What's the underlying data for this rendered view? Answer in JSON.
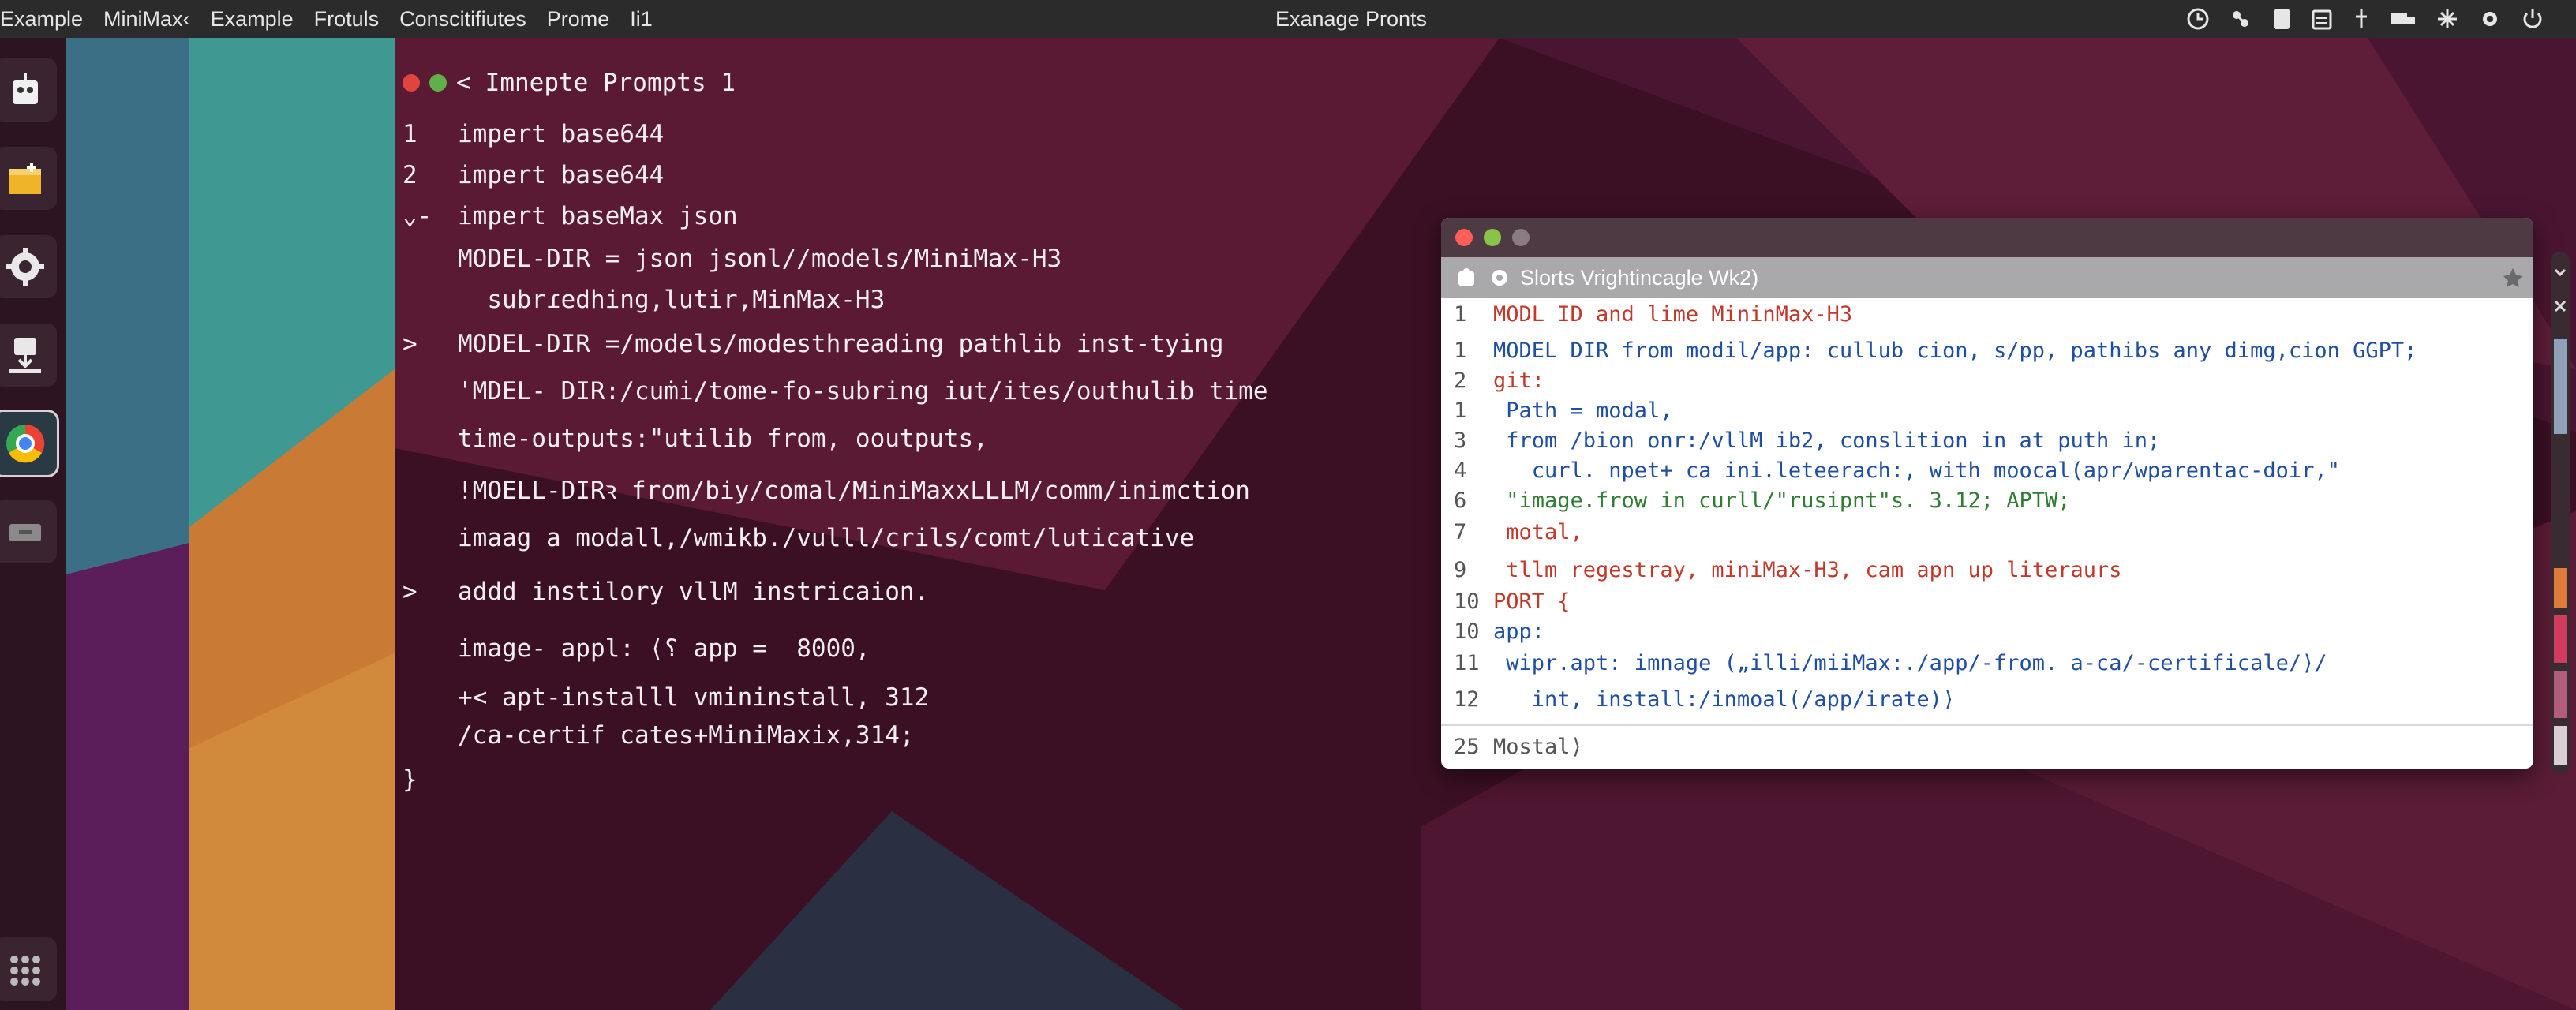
{
  "topbar": {
    "menu": [
      "Example",
      "MiniMax‹",
      "Example",
      "Frotuls",
      "Conscitifiutes",
      "Prome",
      "Ii1"
    ],
    "title": "Exanage Pronts"
  },
  "colors": {
    "topbar_bg": "#2b2b2b",
    "wall_dark": "#3b1024",
    "wall_mid": "#5a1a34",
    "teal": "#3d8a8e",
    "orange": "#d98a36",
    "purple": "#6a1f66",
    "code_red": "#c0392b",
    "code_blue": "#1f4fa0",
    "code_green": "#2e7d32"
  },
  "dock": {
    "icons": [
      "robot-icon",
      "package-icon",
      "gear-icon",
      "download-icon",
      "browser-icon",
      "drawer-icon",
      "app-grid-icon"
    ]
  },
  "editor": {
    "title": "Imnepte Prompts 1",
    "lines": [
      {
        "gutter": "1",
        "text": "impert base644"
      },
      {
        "gutter": "2",
        "text": "impert base644"
      },
      {
        "gutter": "⌄-",
        "text": "impert baseMax json"
      },
      {
        "gutter": "",
        "text": "MODEL-DIR = json jsonl//models/MiniMax-H3"
      },
      {
        "gutter": "",
        "text": "  subrɾedhing,lutir,MinMax-H3"
      },
      {
        "gutter": ">",
        "text": "MODEL-DIR =/models/modesthreading pathlib inst-tying"
      },
      {
        "gutter": "",
        "text": "'MDEL- DIR:/cuṁi/tome-fo-subring iut/ites/outhulib time"
      },
      {
        "gutter": "",
        "text": "time-outputs:\"utilib from, ooutputs,"
      },
      {
        "gutter": "",
        "text": "!MOELL-DIRꝛ from/biy/comal/MiniMaxxLLLM/comm/inimction"
      },
      {
        "gutter": "",
        "text": "imaag a modall,/wmikb./vulll/crils/comt/luticative"
      },
      {
        "gutter": ">",
        "text": "addd instilory vllM instricaion."
      },
      {
        "gutter": "",
        "text": "image- appl: ⟨⸮ app =  8000,"
      },
      {
        "gutter": "",
        "text": "+< apt-installl vmininstall, 312"
      },
      {
        "gutter": "",
        "text": "/ca-certif cates+MiniMaxix,314;"
      },
      {
        "gutter": "}",
        "text": ""
      }
    ]
  },
  "window": {
    "toolbar_title": "Slorts Vrightincagle Wk2)",
    "lines": [
      {
        "ln": "1",
        "color": "red",
        "code": "MODL ID and lime MininMax-H3"
      },
      {
        "ln": "1",
        "color": "mixed1",
        "code": "MODEL DIR from modil/app: cullub cion, s/pp, pathibs any dimg,cion GGPT;"
      },
      {
        "ln": "2",
        "color": "red",
        "code": "git:"
      },
      {
        "ln": "1",
        "color": "blue",
        "code": " Path = modal,"
      },
      {
        "ln": "3",
        "color": "blue",
        "code": " from /bion onr:/vllM ib2, conslition in at puth in;"
      },
      {
        "ln": "4",
        "color": "blue",
        "code": "   curl. npet+ ca ini.leteerach:, with moocal(apr/wparentac-doir,\""
      },
      {
        "ln": "6",
        "color": "mixed2",
        "code": " \"image.frow in curll/\"rusipnt\"s. 3.12; APTW;"
      },
      {
        "ln": "7",
        "color": "red",
        "code": " motal,"
      },
      {
        "ln": "9",
        "color": "mixed3",
        "code": " tllm regestray, miniMax-H3, cam apn up literaurs"
      },
      {
        "ln": "10",
        "color": "red",
        "code": "PORT {"
      },
      {
        "ln": "10",
        "color": "blue",
        "code": "app:"
      },
      {
        "ln": "11",
        "color": "blue",
        "code": " wipr.apt: imnage („illi/miiMax:./app/-from. a-ca/-certificale/⟩/"
      },
      {
        "ln": "12",
        "color": "blue",
        "code": "   int, install:/inmoal(/app/irate)⟩"
      },
      {
        "ln": "25",
        "color": "gray",
        "code": "Mostal⟩"
      }
    ]
  }
}
